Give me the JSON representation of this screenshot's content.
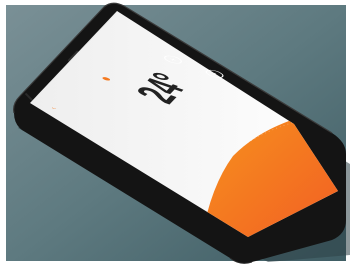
{
  "scene": {
    "background_color": "#5e7a80",
    "device_color": "#141414",
    "screen_color": "#f7f7f7",
    "accent_color": "#f47920"
  },
  "thermostat_app": {
    "header_title": "",
    "mode_label": "",
    "setpoint": "24°",
    "plus_symbol": "+",
    "minus_symbol": "−"
  }
}
